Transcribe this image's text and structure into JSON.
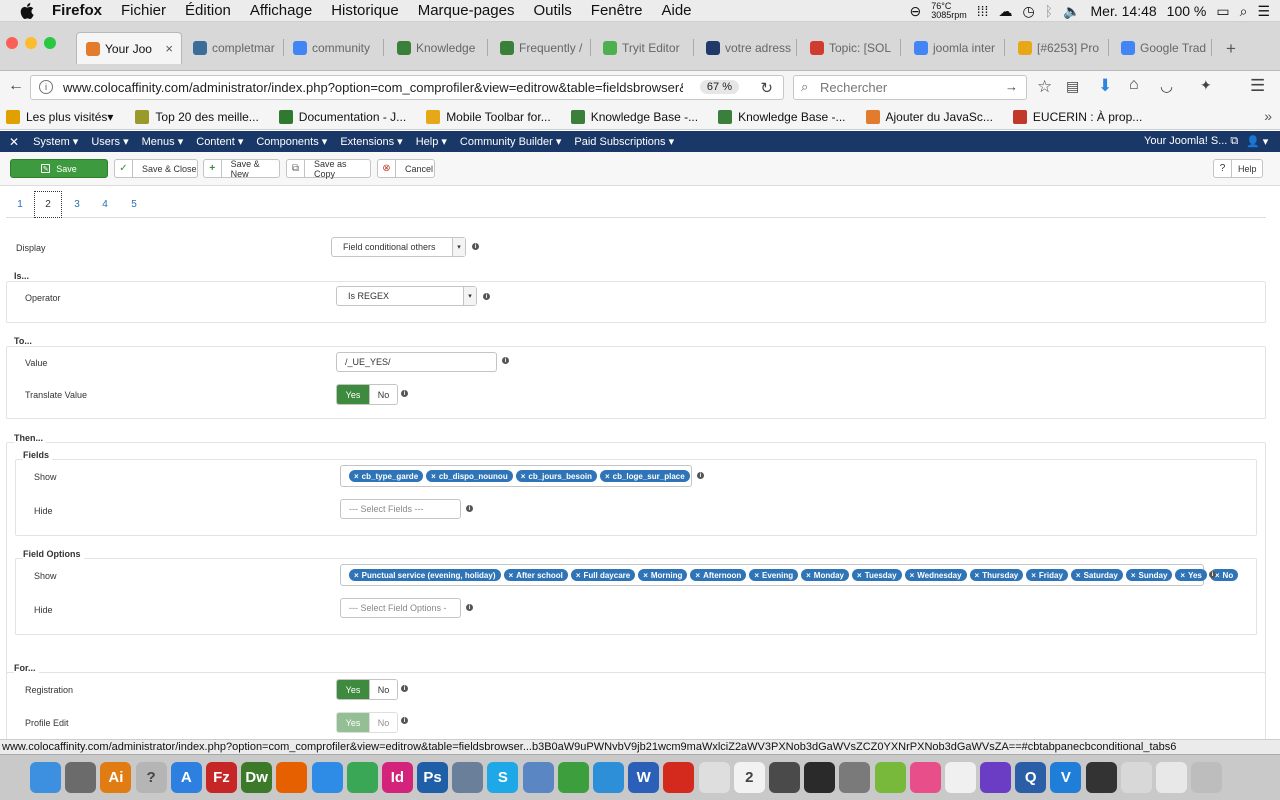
{
  "macos_menubar": {
    "app": "Firefox",
    "items": [
      "Fichier",
      "Édition",
      "Affichage",
      "Historique",
      "Marque-pages",
      "Outils",
      "Fenêtre",
      "Aide"
    ],
    "temp_line1": "76°C",
    "temp_line2": "3085rpm",
    "clock": "Mer. 14:48",
    "battery": "100 %"
  },
  "browser": {
    "tabs": [
      {
        "label": "Your Joo",
        "color": "#e27b2b"
      },
      {
        "label": "completmar",
        "color": "#3b6d9a"
      },
      {
        "label": "community",
        "color": "#4285f4"
      },
      {
        "label": "Knowledge",
        "color": "#3a7f3a"
      },
      {
        "label": "Frequently /",
        "color": "#3a7f3a"
      },
      {
        "label": "Tryit Editor",
        "color": "#4caf50"
      },
      {
        "label": "votre adress",
        "color": "#1f3a6a"
      },
      {
        "label": "Topic: [SOL",
        "color": "#d03c2f"
      },
      {
        "label": "joomla inter",
        "color": "#4285f4"
      },
      {
        "label": "[#6253] Pro",
        "color": "#e6a817"
      },
      {
        "label": "Google Trad",
        "color": "#4285f4"
      }
    ],
    "url": "www.colocaffinity.com/administrator/index.php?option=com_comprofiler&view=editrow&table=fieldsbrowser&",
    "zoom": "67 %",
    "search_placeholder": "Rechercher",
    "bookmarks": [
      {
        "label": "Les plus visités",
        "color": "#e0a000"
      },
      {
        "label": "Top 20 des meille...",
        "color": "#9a9a2a"
      },
      {
        "label": "Documentation - J...",
        "color": "#2f7a2f"
      },
      {
        "label": "Mobile Toolbar for...",
        "color": "#e6a817"
      },
      {
        "label": "Knowledge Base -...",
        "color": "#3a7f3a"
      },
      {
        "label": "Knowledge Base -...",
        "color": "#3a7f3a"
      },
      {
        "label": "Ajouter du JavaSc...",
        "color": "#e27b2b"
      },
      {
        "label": "EUCERIN : À prop...",
        "color": "#c0392b"
      }
    ],
    "status_url": "www.colocaffinity.com/administrator/index.php?option=com_comprofiler&view=editrow&table=fieldsbrowser...b3B0aW9uPWNvbV9jb21wcm9maWxlciZ2aWV3PXNob3dGaWVsZCZ0YXNrPXNob3dGaWVsZA==#cbtabpanecbconditional_tabs6"
  },
  "joomla": {
    "menu": [
      "System",
      "Users",
      "Menus",
      "Content",
      "Components",
      "Extensions",
      "Help",
      "Community Builder",
      "Paid Subscriptions"
    ],
    "site_link": "Your Joomla! S...",
    "toolbar": {
      "save": "Save",
      "save_close": "Save & Close",
      "save_new": "Save & New",
      "save_copy": "Save as Copy",
      "cancel": "Cancel",
      "help": "Help"
    },
    "condition_tabs": [
      "1",
      "2",
      "3",
      "4",
      "5"
    ],
    "active_tab": "2",
    "form": {
      "display_label": "Display",
      "display_value": "Field conditional others",
      "is_legend": "Is...",
      "operator_label": "Operator",
      "operator_value": "Is REGEX",
      "to_legend": "To...",
      "value_label": "Value",
      "value_value": "/_UE_YES/",
      "translate_label": "Translate Value",
      "then_legend": "Then...",
      "fields_legend": "Fields",
      "fields_show_label": "Show",
      "fields_show": [
        "cb_type_garde",
        "cb_dispo_nounou",
        "cb_jours_besoin",
        "cb_loge_sur_place"
      ],
      "fields_hide_label": "Hide",
      "fields_hide_placeholder": "--- Select Fields ---",
      "field_options_legend": "Field Options",
      "options_show_label": "Show",
      "options_show": [
        "Punctual service (evening, holiday)",
        "After school",
        "Full daycare",
        "Morning",
        "Afternoon",
        "Evening",
        "Monday",
        "Tuesday",
        "Wednesday",
        "Thursday",
        "Friday",
        "Saturday",
        "Sunday",
        "Yes",
        "No"
      ],
      "options_hide_label": "Hide",
      "options_hide_placeholder": "--- Select Field Options -",
      "for_legend": "For...",
      "registration_label": "Registration",
      "profile_edit_label": "Profile Edit",
      "yes": "Yes",
      "no": "No",
      "chip_x": "×"
    }
  },
  "dock": [
    {
      "name": "finder",
      "color": "#3d8fe0",
      "glyph": ""
    },
    {
      "name": "launchpad",
      "color": "#6b6b6b",
      "glyph": ""
    },
    {
      "name": "illustrator",
      "color": "#e07c12",
      "glyph": "Ai"
    },
    {
      "name": "help",
      "color": "#b5b5b5",
      "glyph": "?"
    },
    {
      "name": "app-store",
      "color": "#2d7fe0",
      "glyph": "A"
    },
    {
      "name": "filezilla",
      "color": "#c72626",
      "glyph": "Fz"
    },
    {
      "name": "dreamweaver",
      "color": "#3c7a2a",
      "glyph": "Dw"
    },
    {
      "name": "firefox",
      "color": "#e66000",
      "glyph": ""
    },
    {
      "name": "safari",
      "color": "#2f8ce6",
      "glyph": ""
    },
    {
      "name": "chrome",
      "color": "#3aa757",
      "glyph": ""
    },
    {
      "name": "indesign",
      "color": "#d4237a",
      "glyph": "Id"
    },
    {
      "name": "photoshop",
      "color": "#1f5fa8",
      "glyph": "Ps"
    },
    {
      "name": "preview",
      "color": "#6a7f99",
      "glyph": ""
    },
    {
      "name": "skype",
      "color": "#1ea8e8",
      "glyph": "S"
    },
    {
      "name": "mail",
      "color": "#5a86c4",
      "glyph": ""
    },
    {
      "name": "sourcetree",
      "color": "#3d9e3d",
      "glyph": ""
    },
    {
      "name": "sublime",
      "color": "#2d8fd8",
      "glyph": ""
    },
    {
      "name": "word",
      "color": "#2b5fb8",
      "glyph": "W"
    },
    {
      "name": "acrobat",
      "color": "#d42a1e",
      "glyph": ""
    },
    {
      "name": "textedit",
      "color": "#dedede",
      "glyph": ""
    },
    {
      "name": "calendar",
      "color": "#f2f2f2",
      "glyph": "2"
    },
    {
      "name": "utility",
      "color": "#4a4a4a",
      "glyph": ""
    },
    {
      "name": "activity-monitor",
      "color": "#2a2a2a",
      "glyph": ""
    },
    {
      "name": "system-preferences",
      "color": "#7a7a7a",
      "glyph": ""
    },
    {
      "name": "android-file-transfer",
      "color": "#78b83a",
      "glyph": ""
    },
    {
      "name": "itunes",
      "color": "#e84f8a",
      "glyph": ""
    },
    {
      "name": "photos",
      "color": "#f0f0f0",
      "glyph": ""
    },
    {
      "name": "imovie",
      "color": "#6a3dc4",
      "glyph": ""
    },
    {
      "name": "quicktime",
      "color": "#2a5fa8",
      "glyph": "Q"
    },
    {
      "name": "vectorworks",
      "color": "#1f7fd8",
      "glyph": "V"
    },
    {
      "name": "dvd-player",
      "color": "#333333",
      "glyph": ""
    },
    {
      "name": "documents",
      "color": "#d8d8d8",
      "glyph": ""
    },
    {
      "name": "files",
      "color": "#e8e8e8",
      "glyph": ""
    },
    {
      "name": "trash",
      "color": "#bdbdbd",
      "glyph": ""
    }
  ]
}
